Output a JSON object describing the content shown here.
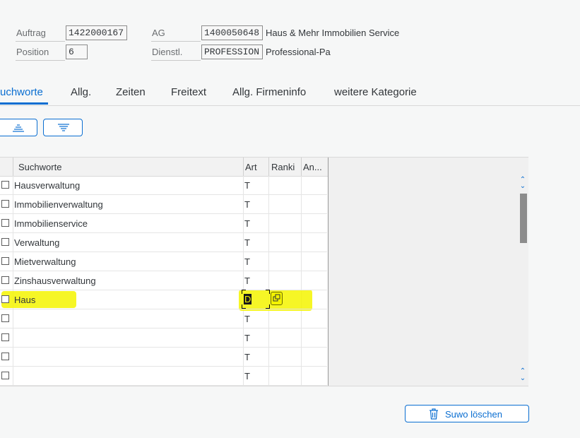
{
  "header": {
    "auftrag_label": "Auftrag",
    "auftrag_value": "1422000167",
    "position_label": "Position",
    "position_value": "6",
    "ag_label": "AG",
    "ag_value": "1400050648",
    "ag_text": "Haus & Mehr Immobilien Service",
    "dienstl_label": "Dienstl.",
    "dienstl_value": "PROFESSION",
    "dienstl_text": "Professional-Pa"
  },
  "tabs": [
    {
      "label": "uchworte",
      "active": true
    },
    {
      "label": "Allg."
    },
    {
      "label": "Zeiten"
    },
    {
      "label": "Freitext"
    },
    {
      "label": "Allg. Firmeninfo"
    },
    {
      "label": "weitere Kategorie"
    }
  ],
  "toolbar": {
    "sort_ascending_icon": "sort-ascending-icon",
    "sort_descending_icon": "sort-descending-icon"
  },
  "grid": {
    "columns": [
      "Suchworte",
      "Art",
      "Ranki",
      "An..."
    ],
    "rows": [
      {
        "keyword": "Hausverwaltung",
        "art": "T"
      },
      {
        "keyword": "Immobilienverwaltung",
        "art": "T"
      },
      {
        "keyword": "Immobilienservice",
        "art": "T"
      },
      {
        "keyword": "Verwaltung",
        "art": "T"
      },
      {
        "keyword": "Mietverwaltung",
        "art": "T"
      },
      {
        "keyword": "Zinshausverwaltung",
        "art": "T"
      },
      {
        "keyword": "Haus",
        "art": "D",
        "editing": true
      },
      {
        "keyword": "",
        "art": "T"
      },
      {
        "keyword": "",
        "art": "T"
      },
      {
        "keyword": "",
        "art": "T"
      },
      {
        "keyword": "",
        "art": "T"
      }
    ]
  },
  "actions": {
    "delete_label": "Suwo löschen",
    "delete_icon": "trash-icon"
  },
  "colors": {
    "accent": "#0a6ed1",
    "highlight": "#f4f400"
  }
}
